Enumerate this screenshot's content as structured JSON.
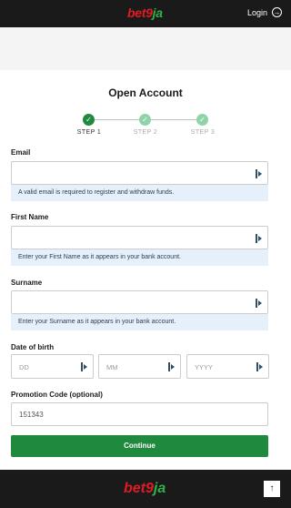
{
  "header": {
    "logo_bet": "bet",
    "logo_9": "9",
    "logo_ja": "ja",
    "login_label": "Login"
  },
  "page": {
    "title": "Open Account"
  },
  "steps": [
    {
      "label": "STEP 1",
      "state": "active"
    },
    {
      "label": "STEP 2",
      "state": "inactive"
    },
    {
      "label": "STEP 3",
      "state": "inactive"
    }
  ],
  "form": {
    "email_label": "Email",
    "email_value": "",
    "email_hint": "A valid email is required to register and withdraw funds.",
    "first_name_label": "First Name",
    "first_name_value": "",
    "first_name_hint": "Enter your First Name as it appears in your bank account.",
    "surname_label": "Surname",
    "surname_value": "",
    "surname_hint": "Enter your Surname as it appears in your bank account.",
    "dob_label": "Date of birth",
    "dob_day_placeholder": "DD",
    "dob_month_placeholder": "MM",
    "dob_year_placeholder": "YYYY",
    "promo_label": "Promotion Code (optional)",
    "promo_value": "151343",
    "continue_label": "Continue"
  },
  "footer": {
    "logo_bet": "bet",
    "logo_9": "9",
    "logo_ja": "ja",
    "back_to_top_icon": "arrow-up-icon"
  },
  "colors": {
    "brand_red": "#e21b23",
    "brand_green": "#2eb24b",
    "primary_button": "#1f8a3e",
    "hint_bg": "#e6f0fa",
    "dark": "#1a1a1a"
  }
}
